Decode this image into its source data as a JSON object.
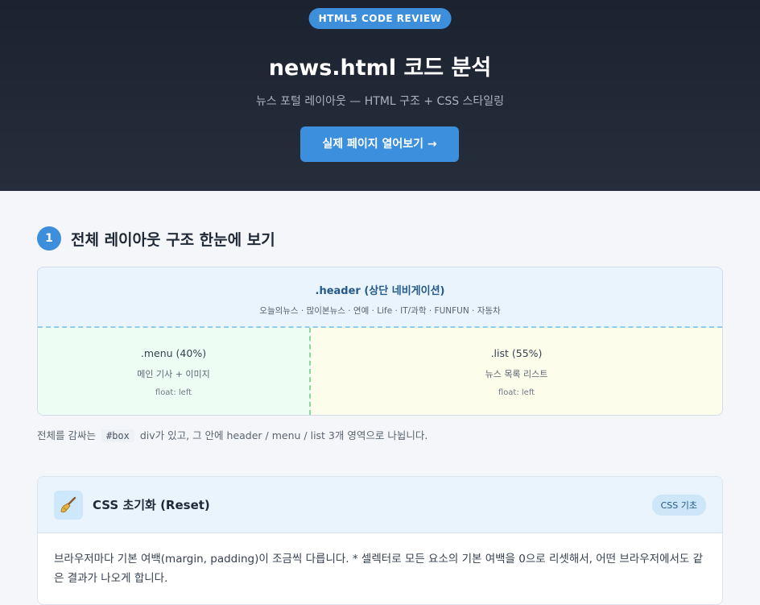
{
  "hero": {
    "badge": "HTML5 CODE REVIEW",
    "title": "news.html 코드 분석",
    "subtitle": "뉴스 포털 레이아웃 — HTML 구조 + CSS 스타일링",
    "button": "실제 페이지 열어보기 →"
  },
  "section1": {
    "number": "1",
    "title": "전체 레이아웃 구조 한눈에 보기"
  },
  "layout": {
    "header_title": ".header (상단 네비게이션)",
    "header_sub": "오늘의뉴스 · 많이본뉴스 · 연예 · Life · IT/과학 · FUNFUN · 자동차",
    "menu_title": ".menu (40%)",
    "menu_desc": "메인 기사 + 이미지",
    "menu_float": "float: left",
    "list_title": ".list (55%)",
    "list_desc": "뉴스 목록 리스트",
    "list_float": "float: left"
  },
  "caption": {
    "before": "전체를 감싸는",
    "code": "#box",
    "after": "div가 있고, 그 안에 header / menu / list 3개 영역으로 나뉩니다."
  },
  "card": {
    "icon": "broom-icon",
    "title": "CSS 초기화 (Reset)",
    "tag": "CSS 기초",
    "body": "브라우저마다 기본 여백(margin, padding)이 조금씩 다릅니다. * 셀렉터로 모든 요소의 기본 여백을 0으로 리셋해서, 어떤 브라우저에서도 같은 결과가 나오게 합니다."
  },
  "colors": {
    "accent": "#3d8fdc",
    "hero_bg": "#1b2230"
  }
}
